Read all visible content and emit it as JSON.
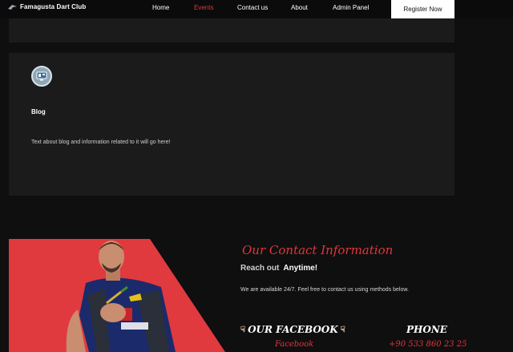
{
  "nav": {
    "brand": "Famagusta Dart Club",
    "links": [
      "Home",
      "Events",
      "Contact us",
      "About",
      "Admin Panel"
    ],
    "active": "Events",
    "register_label": "Register Now"
  },
  "blog_card": {
    "icon": "computer-icon",
    "title": "Blog",
    "text": "Text about blog and information related to it will go here!"
  },
  "contact": {
    "title": "Our Contact Information",
    "reach_out_1": "Reach out",
    "reach_out_2": "Anytime!",
    "availability": "We are available 24/7. Feel free to contact us using methods below.",
    "facebook_heading": "OUR FACEBOOK",
    "facebook_link": "Facebook",
    "phone_heading": "PHONE",
    "phone_number": "+90 533 860 23 25"
  },
  "colors": {
    "accent": "#e0353d",
    "background": "#0f0f0f",
    "card": "#1b1b1b"
  }
}
